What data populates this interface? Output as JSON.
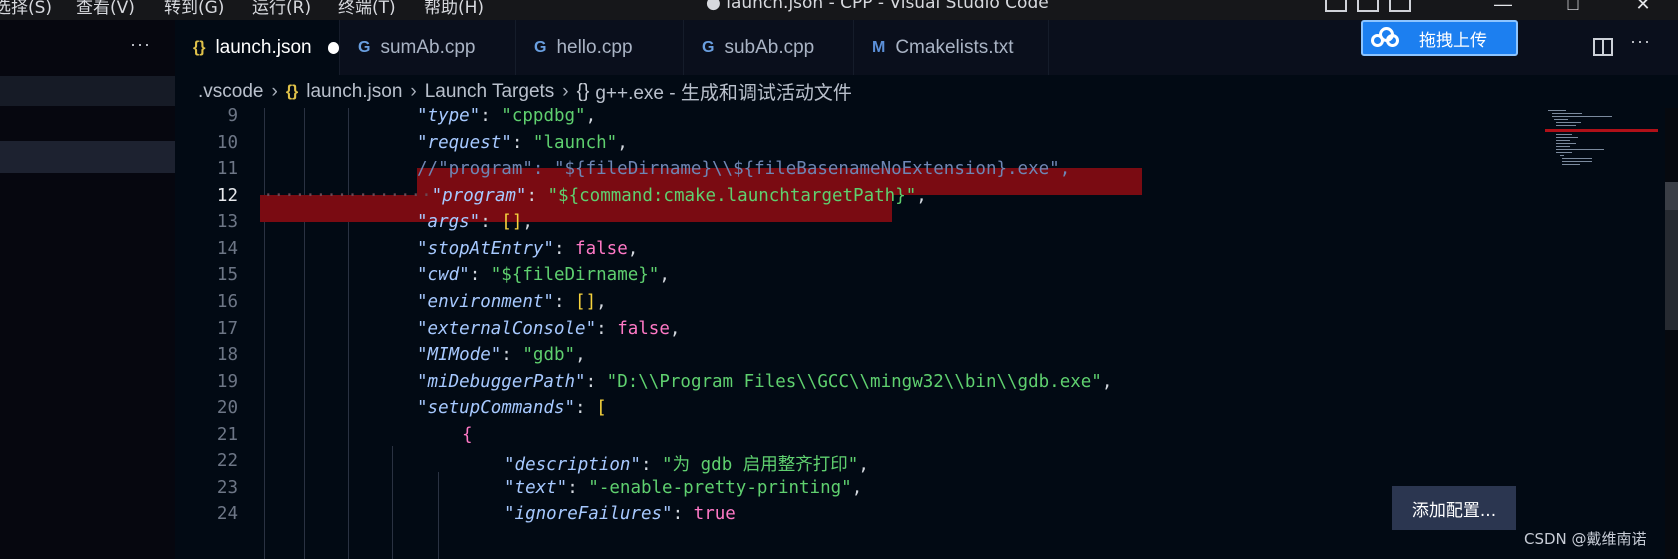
{
  "menu": [
    "选择(S)",
    "查看(V)",
    "转到(G)",
    "运行(R)",
    "终端(T)",
    "帮助(H)"
  ],
  "window_title": "● launch.json - CPP - Visual Studio Code",
  "sidebar": {
    "more": "···"
  },
  "tabs": [
    {
      "icon": "{}",
      "label": "launch.json"
    },
    {
      "icon": "G",
      "label": "sumAb.cpp"
    },
    {
      "icon": "G",
      "label": "hello.cpp"
    },
    {
      "icon": "G",
      "label": "subAb.cpp"
    },
    {
      "icon": "M",
      "label": "Cmakelists.txt"
    }
  ],
  "upload_label": "拖拽上传",
  "tab_more": "···",
  "breadcrumb": {
    "folder": ".vscode",
    "file_icon": "{}",
    "file": "launch.json",
    "section": "Launch Targets",
    "obj_icon": "{}",
    "item": "g++.exe - 生成和调试活动文件"
  },
  "lines": [
    "9",
    "10",
    "11",
    "12",
    "13",
    "14",
    "15",
    "16",
    "17",
    "18",
    "19",
    "20",
    "21",
    "22",
    "23",
    "24"
  ],
  "code": {
    "l9": {
      "key": "\"type\"",
      "val": "\"cppdbg\""
    },
    "l10": {
      "key": "\"request\"",
      "val": "\"launch\""
    },
    "l11": {
      "comment": "//\"program\": \"${fileDirname}\\\\${fileBasenameNoExtension}.exe\","
    },
    "l12": {
      "key": "\"program\"",
      "val": "\"${command:cmake.launchtargetPath}\""
    },
    "l13": {
      "key": "\"args\"",
      "val": "[]"
    },
    "l14": {
      "key": "\"stopAtEntry\"",
      "val": "false"
    },
    "l15": {
      "key": "\"cwd\"",
      "val": "\"${fileDirname}\""
    },
    "l16": {
      "key": "\"environment\"",
      "val": "[]"
    },
    "l17": {
      "key": "\"externalConsole\"",
      "val": "false"
    },
    "l18": {
      "key": "\"MIMode\"",
      "val": "\"gdb\""
    },
    "l19": {
      "key": "\"miDebuggerPath\"",
      "val": "\"D:\\\\Program Files\\\\GCC\\\\mingw32\\\\bin\\\\gdb.exe\""
    },
    "l20": {
      "key": "\"setupCommands\"",
      "val": "["
    },
    "l21": {
      "val": "{"
    },
    "l22": {
      "key": "\"description\"",
      "val": "\"为 gdb 启用整齐打印\""
    },
    "l23": {
      "key": "\"text\"",
      "val": "\"-enable-pretty-printing\""
    },
    "l24": {
      "key": "\"ignoreFailures\"",
      "val": "true"
    }
  },
  "add_config_label": "添加配置...",
  "watermark": "CSDN @戴维南诺",
  "colors": {
    "highlight": "#7a0b12",
    "string": "#5fd06f",
    "key": "#a7c9ff",
    "bool": "#ff79c6",
    "bracket": "#f6d33d"
  }
}
